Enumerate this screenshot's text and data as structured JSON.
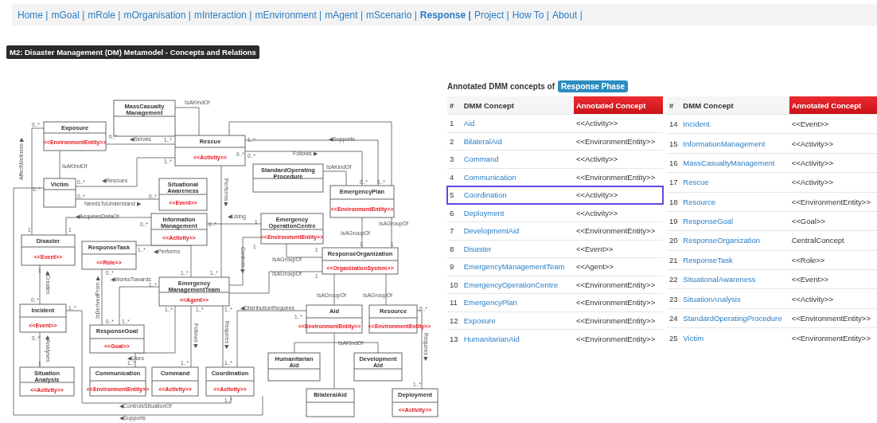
{
  "nav": {
    "items": [
      {
        "label": "Home |",
        "selected": false
      },
      {
        "label": "mGoal |",
        "selected": false
      },
      {
        "label": "mRole |",
        "selected": false
      },
      {
        "label": "mOrganisation |",
        "selected": false
      },
      {
        "label": "mInteraction |",
        "selected": false
      },
      {
        "label": "mEnvironment |",
        "selected": false
      },
      {
        "label": "mAgent |",
        "selected": false
      },
      {
        "label": "mScenario |",
        "selected": false
      },
      {
        "label": "Response |",
        "selected": true
      },
      {
        "label": "Project |",
        "selected": false
      },
      {
        "label": "How To |",
        "selected": false
      },
      {
        "label": "About |",
        "selected": false
      }
    ]
  },
  "title": "M2: Disaster Management (DM) Metamodel - Concepts and Relations",
  "diagram": {
    "nodes": [
      {
        "name_lines": [
          "MassCasualty",
          "Management"
        ]
      },
      {
        "name_lines": [
          "Exposure"
        ],
        "stereotype": "<<EnvironmentEntity>>"
      },
      {
        "name_lines": [
          "Rescue"
        ],
        "stereotype": "<<Activity>>"
      },
      {
        "name_lines": [
          "Victim"
        ]
      },
      {
        "name_lines": [
          "Situational",
          "Awareness"
        ],
        "stereotype": "<<Event>>"
      },
      {
        "name_lines": [
          "StandardOperating",
          "Procedure"
        ]
      },
      {
        "name_lines": [
          "EmergencyPlan"
        ],
        "stereotype": "<<EnvironmentEntity>>"
      },
      {
        "name_lines": [
          "Information",
          "Management"
        ],
        "stereotype": "<<Activity>>"
      },
      {
        "name_lines": [
          "Emergency",
          "OperationCentre"
        ],
        "stereotype": "<<EnvironmentEntity>>"
      },
      {
        "name_lines": [
          "Disaster"
        ],
        "stereotype": "<<Event>>"
      },
      {
        "name_lines": [
          "ResponseTask"
        ],
        "stereotype": "<<Role>>"
      },
      {
        "name_lines": [
          "ResponseOrganization"
        ],
        "stereotype": "<<OrganizationSystem>>"
      },
      {
        "name_lines": [
          "Emergency",
          "ManagementTeam"
        ],
        "stereotype": "<<Agent>>"
      },
      {
        "name_lines": [
          "Incident"
        ],
        "stereotype": "<<Event>>"
      },
      {
        "name_lines": [
          "ResponseGoal"
        ],
        "stereotype": "<<Goal>>"
      },
      {
        "name_lines": [
          "Aid"
        ],
        "stereotype": "<<EnvironmentEntity>>"
      },
      {
        "name_lines": [
          "Resource"
        ],
        "stereotype": "<<EnvironmentEntity>>"
      },
      {
        "name_lines": [
          "Humanitarian",
          "Aid"
        ]
      },
      {
        "name_lines": [
          "Development",
          "Aid"
        ]
      },
      {
        "name_lines": [
          "Situation",
          "Analysis"
        ],
        "stereotype": "<<Activity>>"
      },
      {
        "name_lines": [
          "Communication"
        ],
        "stereotype": "<<EnvironmentEntity>>"
      },
      {
        "name_lines": [
          "Command"
        ],
        "stereotype": "<<Activity>>"
      },
      {
        "name_lines": [
          "Coordination"
        ],
        "stereotype": "<<Activity>>"
      },
      {
        "name_lines": [
          "BilateralAid"
        ]
      },
      {
        "name_lines": [
          "Deployment"
        ],
        "stereotype": "<<Activity>>"
      }
    ],
    "relation_labels": [
      "IsAKindOf",
      "◀Serves",
      "IsAKindOf",
      "◀Rescues",
      "NeedsToUnderstand ▶",
      "◀AcquiresDataOf",
      "AffectWellness ▶",
      "◀Supports",
      "Follows ▶",
      "IsAKindOf",
      "Performs ▶",
      "◀Using",
      "IsAGroupOf",
      "IsAGroupOf",
      "Controls ▶",
      "IsAGroupOf",
      "IsAGroupOf",
      "◀Performs",
      "◀WorksTowards",
      "IsDerivedFrom ▶",
      "◀Creates",
      "◀DistributionRequires",
      "IsAGroupOf",
      "IsAGroupOf",
      "IsAKindOf",
      "◀Analyses",
      "◀Uses",
      "Follows ▶",
      "Requires ▶",
      "Requires ▶",
      "◀ControlsSituationOf",
      "◀Supports"
    ],
    "multiplicities": [
      "0..*",
      "0..*",
      "1..*",
      "1..*",
      "0..*",
      "1..*",
      "0..*",
      "0..*",
      "0..*",
      "0..*",
      "0..*",
      "1",
      "1",
      "0..*",
      "0..*",
      "0..*",
      "0..*",
      "1",
      "1",
      "1",
      "1",
      "1",
      "1",
      "1..*",
      "0..*",
      "1..*",
      "1..*",
      "1..*",
      "1",
      "0..*",
      "1..*",
      "0..*",
      "1",
      "0..*",
      "1..*",
      "1..*",
      "1..*",
      "1..*",
      "1..*",
      "0..*",
      "1..*",
      "1..*",
      "1..*",
      "1..*",
      "1..*"
    ]
  },
  "concepts": {
    "heading": "Annotated DMM concepts of",
    "phase": "Response Phase",
    "tables": [
      {
        "columns": [
          "#",
          "DMM Concept",
          "Annotated Concept"
        ],
        "rows": [
          {
            "num": "1",
            "concept": "Aid",
            "annotation": "<<Activity>>",
            "selected": false
          },
          {
            "num": "2",
            "concept": "BilateralAid",
            "annotation": "<<EnvironmentEntity>>",
            "selected": false
          },
          {
            "num": "3",
            "concept": "Command",
            "annotation": "<<Activity>>",
            "selected": false
          },
          {
            "num": "4",
            "concept": "Communication",
            "annotation": "<<EnvironmentEntity>>",
            "selected": false
          },
          {
            "num": "5",
            "concept": "Coordination",
            "annotation": "<<Activity>>",
            "selected": true
          },
          {
            "num": "6",
            "concept": "Deployment",
            "annotation": "<<Activity>>",
            "selected": false
          },
          {
            "num": "7",
            "concept": "DevelopmentAid",
            "annotation": "<<EnvironmentEntity>>",
            "selected": false
          },
          {
            "num": "8",
            "concept": "Disaster",
            "annotation": "<<Event>>",
            "selected": false
          },
          {
            "num": "9",
            "concept": "EmergencyManagementTeam",
            "annotation": "<<Agent>>",
            "selected": false
          },
          {
            "num": "10",
            "concept": "EmergencyOperationCentre",
            "annotation": "<<EnvironmentEntity>>",
            "selected": false
          },
          {
            "num": "11",
            "concept": "EmergencyPlan",
            "annotation": "<<EnvironmentEntity>>",
            "selected": false
          },
          {
            "num": "12",
            "concept": "Exposure",
            "annotation": "<<EnvironmentEntity>>",
            "selected": false
          },
          {
            "num": "13",
            "concept": "HumanitarianAid",
            "annotation": "<<EnvironmentEntity>>",
            "selected": false
          }
        ]
      },
      {
        "columns": [
          "#",
          "DMM Concept",
          "Annotated Concept"
        ],
        "rows": [
          {
            "num": "14",
            "concept": "Incident",
            "annotation": "<<Event>>",
            "selected": false
          },
          {
            "num": "15",
            "concept": "InformationManagement",
            "annotation": "<<Activity>>",
            "selected": false
          },
          {
            "num": "16",
            "concept": "MassCasualtyManagement",
            "annotation": "<<Activity>>",
            "selected": false
          },
          {
            "num": "17",
            "concept": "Rescue",
            "annotation": "<<Activity>>",
            "selected": false
          },
          {
            "num": "18",
            "concept": "Resource",
            "annotation": "<<EnvironmentEntity>>",
            "selected": false
          },
          {
            "num": "19",
            "concept": "ResponseGoal",
            "annotation": "<<Goal>>",
            "selected": false
          },
          {
            "num": "20",
            "concept": "ResponseOrganization",
            "annotation": "CentralConcept",
            "selected": false
          },
          {
            "num": "21",
            "concept": "ResponseTask",
            "annotation": "<<Role>>",
            "selected": false
          },
          {
            "num": "22",
            "concept": "SituationalAwareness",
            "annotation": "<<Event>>",
            "selected": false
          },
          {
            "num": "23",
            "concept": "SituationAnalysis",
            "annotation": "<<Activity>>",
            "selected": false
          },
          {
            "num": "24",
            "concept": "StandardOperatingProcedure",
            "annotation": "<<EnvironmentEntity>>",
            "selected": false
          },
          {
            "num": "25",
            "concept": "Victim",
            "annotation": "<<EnvironmentEntity>>",
            "selected": false
          }
        ]
      }
    ]
  }
}
